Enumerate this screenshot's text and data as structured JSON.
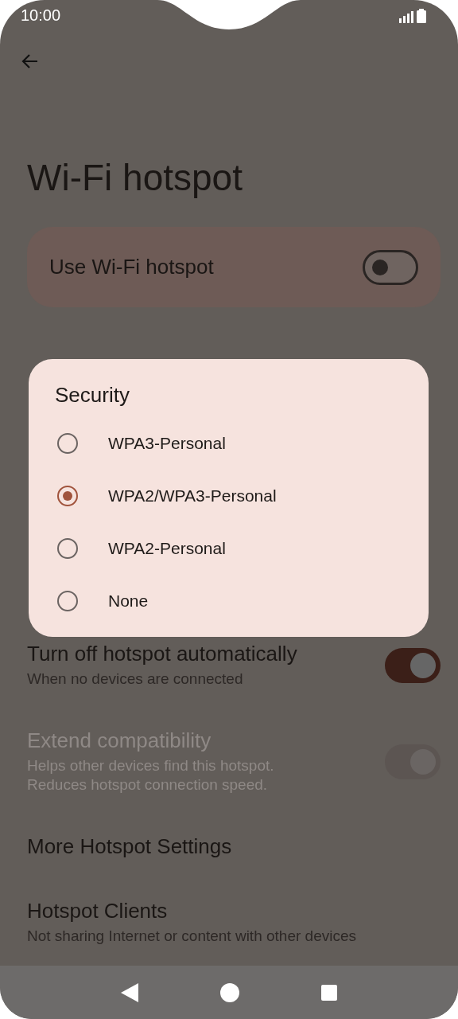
{
  "status_bar": {
    "time": "10:00"
  },
  "title": "Wi-Fi hotspot",
  "main_toggle": {
    "label": "Use Wi-Fi hotspot",
    "on": false
  },
  "settings": [
    {
      "kind": "toggle",
      "title": "Turn off hotspot automatically",
      "subtitle": "When no devices are connected",
      "on": true,
      "disabled": false
    },
    {
      "kind": "toggle",
      "title": "Extend compatibility",
      "subtitle": "Helps other devices find this hotspot.\nReduces hotspot connection speed.",
      "on": true,
      "disabled": true
    },
    {
      "kind": "link",
      "title": "More Hotspot Settings",
      "disabled": false
    },
    {
      "kind": "link",
      "title": "Hotspot Clients",
      "subtitle": "Not sharing Internet or content with other devices",
      "disabled": false
    }
  ],
  "dialog": {
    "title": "Security",
    "options": [
      {
        "label": "WPA3-Personal",
        "selected": false
      },
      {
        "label": "WPA2/WPA3-Personal",
        "selected": true
      },
      {
        "label": "WPA2-Personal",
        "selected": false
      },
      {
        "label": "None",
        "selected": false
      }
    ]
  }
}
